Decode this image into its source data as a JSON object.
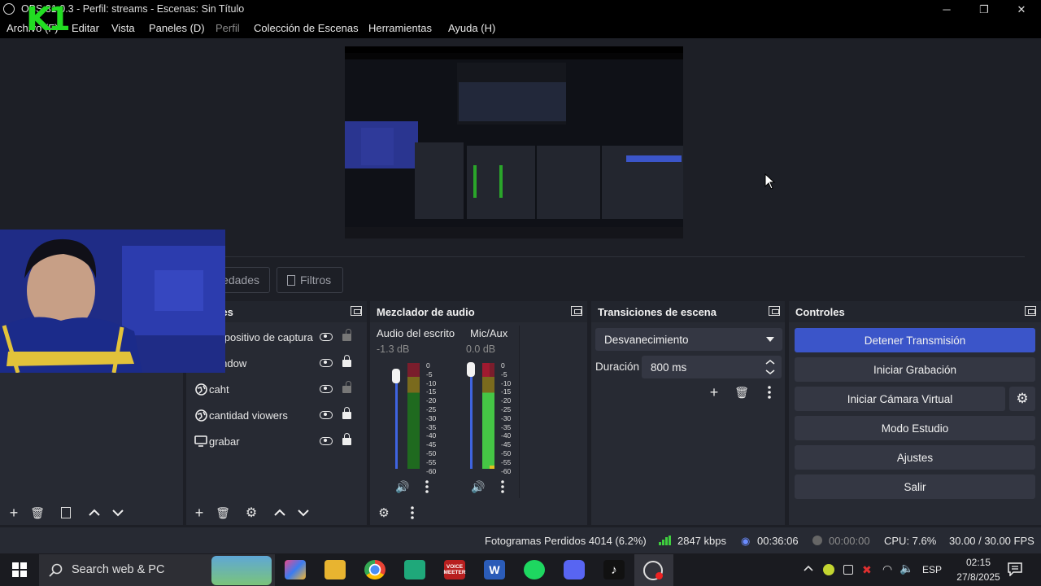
{
  "window": {
    "title": "OBS 31.0.3 - Perfil: streams - Escenas: Sin Título",
    "minimize": "─",
    "maximize": "❐",
    "close": "✕"
  },
  "menu": [
    {
      "label": "Archivo (F)",
      "disabled": false
    },
    {
      "label": "Editar",
      "disabled": false
    },
    {
      "label": "Vista",
      "disabled": false
    },
    {
      "label": "Paneles (D)",
      "disabled": false
    },
    {
      "label": "Perfil",
      "disabled": true
    },
    {
      "label": "Colección de Escenas",
      "disabled": false
    },
    {
      "label": "Herramientas",
      "disabled": false
    },
    {
      "label": "Ayuda (H)",
      "disabled": false
    }
  ],
  "overlay": {
    "logo_text": "K1",
    "logo_color": "#22dd22"
  },
  "tabs": {
    "properties": "Propiedades",
    "filters": "Filtros"
  },
  "sources": {
    "title": "Fuentes",
    "items": [
      {
        "label": "Dispositivo de captura",
        "icon": "camera-icon",
        "locked": false
      },
      {
        "label": "Window",
        "icon": "window-icon",
        "locked": true
      },
      {
        "label": "caht",
        "icon": "globe-icon",
        "locked": false
      },
      {
        "label": "cantidad viowers",
        "icon": "globe-icon",
        "locked": true
      },
      {
        "label": "grabar",
        "icon": "monitor-icon",
        "locked": true
      }
    ]
  },
  "mixer": {
    "title": "Mezclador de audio",
    "channels": [
      {
        "name": "Audio del escrito",
        "db": "-1.3 dB",
        "level": 0.35
      },
      {
        "name": "Mic/Aux",
        "db": "0.0 dB",
        "level": 0.92
      }
    ],
    "scale": [
      "0",
      "-5",
      "-10",
      "-15",
      "-20",
      "-25",
      "-30",
      "-35",
      "-40",
      "-45",
      "-50",
      "-55",
      "-60"
    ]
  },
  "transitions": {
    "title": "Transiciones de escena",
    "selected": "Desvanecimiento",
    "duration_label": "Duración",
    "duration_value": "800 ms"
  },
  "controls": {
    "title": "Controles",
    "buttons": {
      "stop_stream": "Detener Transmisión",
      "start_recording": "Iniciar Grabación",
      "start_virtual_cam": "Iniciar Cámara Virtual",
      "studio_mode": "Modo Estudio",
      "settings": "Ajustes",
      "exit": "Salir"
    },
    "accent": "#3b55c9"
  },
  "status": {
    "dropped_frames": "Fotogramas Perdidos 4014 (6.2%)",
    "bitrate": "2847 kbps",
    "stream_time": "00:36:06",
    "record_time": "00:00:00",
    "cpu": "CPU: 7.6%",
    "fps": "30.00 / 30.00 FPS"
  },
  "taskbar": {
    "search_placeholder": "Search web & PC",
    "language": "ESP",
    "time": "02:15",
    "date": "27/8/2025",
    "voicemeeter": "VOICE MEETER"
  }
}
